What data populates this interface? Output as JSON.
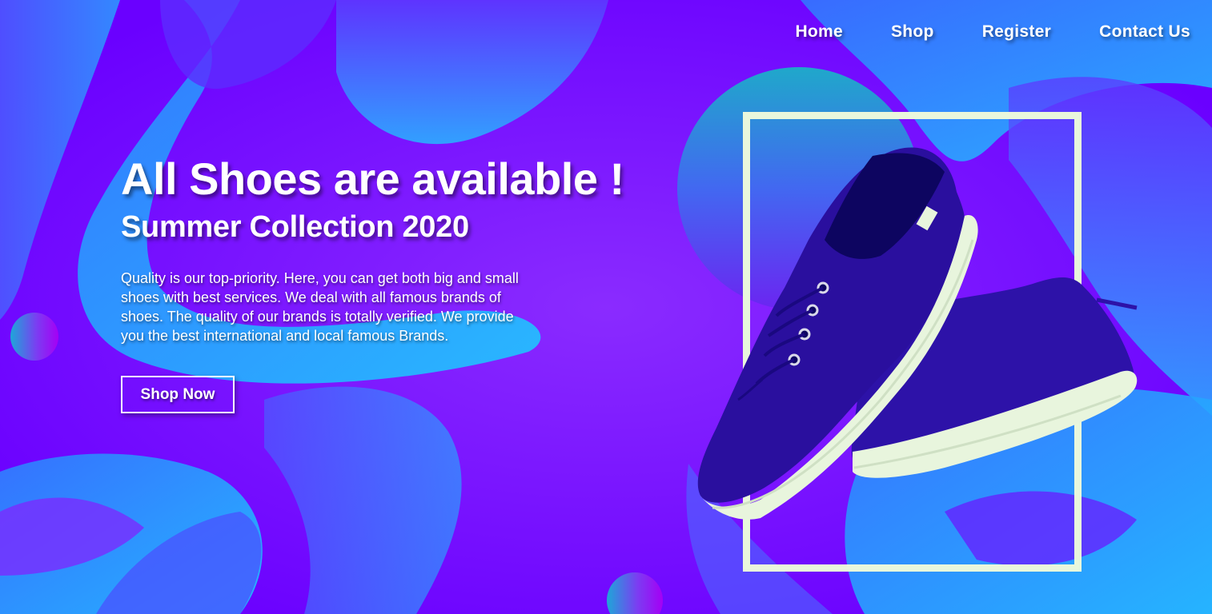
{
  "nav": {
    "items": [
      {
        "label": "Home"
      },
      {
        "label": "Shop"
      },
      {
        "label": "Register"
      },
      {
        "label": "Contact Us"
      }
    ]
  },
  "hero": {
    "title": "All Shoes are available !",
    "subtitle": "Summer Collection 2020",
    "description": "Quality is our top-priority. Here, you can get both big and small shoes with best services. We deal with all famous brands of shoes. The quality of our brands is totally verified. We provide you the best international and local famous Brands.",
    "cta_label": "Shop Now"
  },
  "theme": {
    "primary_purple": "#6a00ff",
    "cyan": "#1ec8ff",
    "frame_color": "#e9f7dc",
    "shoe_color": "#2a0fa0",
    "sole_color": "#e8f5dd"
  },
  "icons": {
    "product_image": "sneaker-image",
    "decor": [
      "circle-decor-left",
      "circle-decor-bottom",
      "circle-decor-big"
    ]
  }
}
